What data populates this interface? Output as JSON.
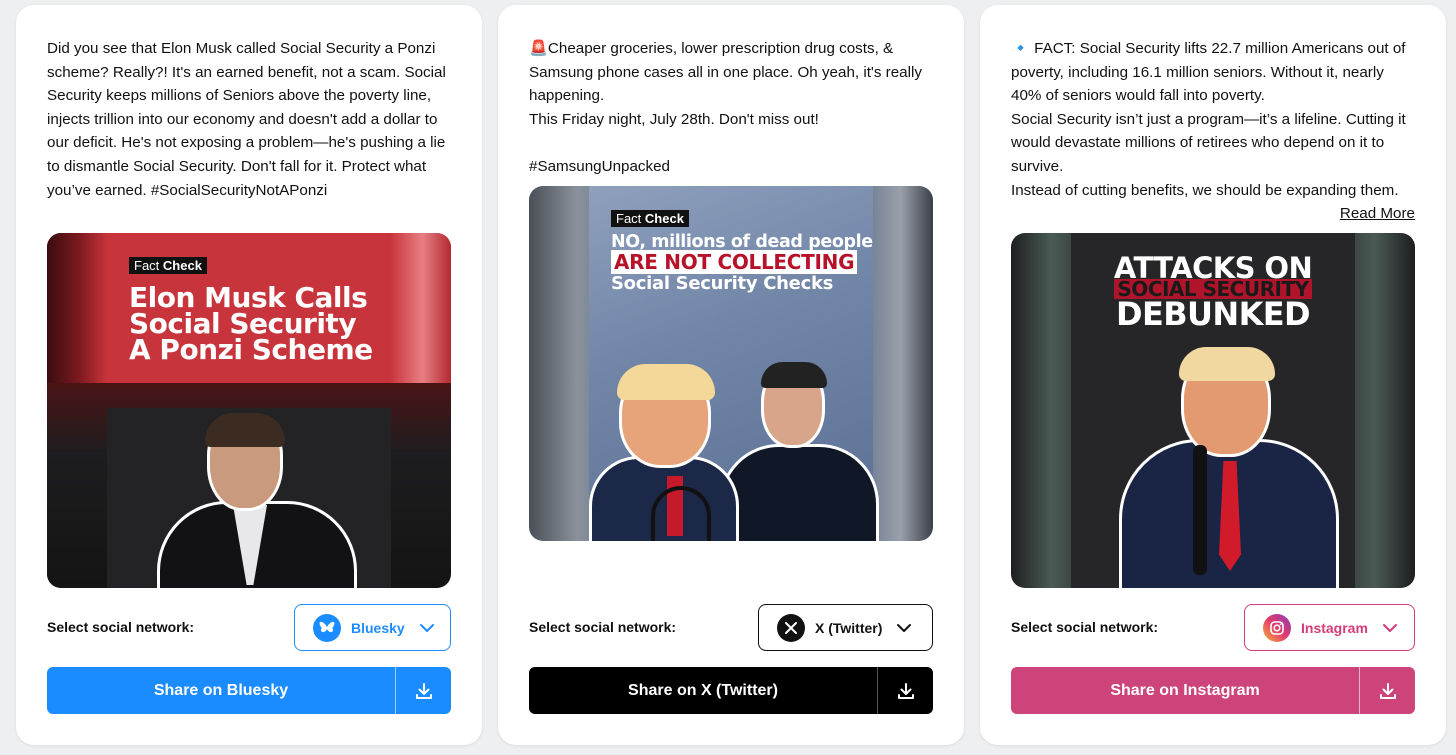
{
  "select_label": "Select social network:",
  "cards": [
    {
      "text": [
        "Did you see that Elon Musk called Social Security a Ponzi scheme? Really?! It's an earned benefit, not a scam. Social Security keeps millions of Seniors above the poverty line, injects trillion into our economy and doesn't add a dollar to our deficit. He's not exposing a problem—he's pushing a lie to dismantle Social Security. Don't fall for it. Protect what you’ve earned. #SocialSecurityNotAPonzi"
      ],
      "image": {
        "badge_light": "Fact ",
        "badge_bold": "Check",
        "headline_lines": [
          "Elon Musk Calls",
          "Social Security",
          "A Ponzi Scheme"
        ]
      },
      "network": "Bluesky",
      "network_icon": "butterfly-icon",
      "share_label": "Share on Bluesky",
      "accent": "#1a8cff"
    },
    {
      "text": [
        "🚨Cheaper groceries, lower prescription drug costs, & Samsung phone cases all in one place. Oh yeah, it's really happening.",
        "This Friday night, July 28th. Don't miss out!",
        "",
        "#SamsungUnpacked"
      ],
      "image": {
        "badge_light": "Fact ",
        "badge_bold": "Check",
        "line1": "NO, millions of dead people",
        "line2": "ARE NOT COLLECTING",
        "line3": "Social Security Checks"
      },
      "network": "X (Twitter)",
      "network_icon": "x-logo-icon",
      "share_label": "Share on X (Twitter)",
      "accent": "#000000"
    },
    {
      "text": [
        "🔹 FACT: Social Security lifts 22.7 million Americans out of poverty, including 16.1 million seniors. Without it, nearly 40% of seniors would fall into poverty.",
        "Social Security isn’t just a program—it’s a lifeline. Cutting it would devastate millions of retirees who depend on it to survive.",
        "Instead of cutting benefits, we should be expanding them."
      ],
      "read_more": "Read More",
      "image": {
        "line1": "ATTACKS ON",
        "line2": "SOCIAL SECURITY",
        "line3": "DEBUNKED"
      },
      "network": "Instagram",
      "network_icon": "instagram-icon",
      "share_label": "Share on Instagram",
      "accent": "#cc4479"
    }
  ]
}
